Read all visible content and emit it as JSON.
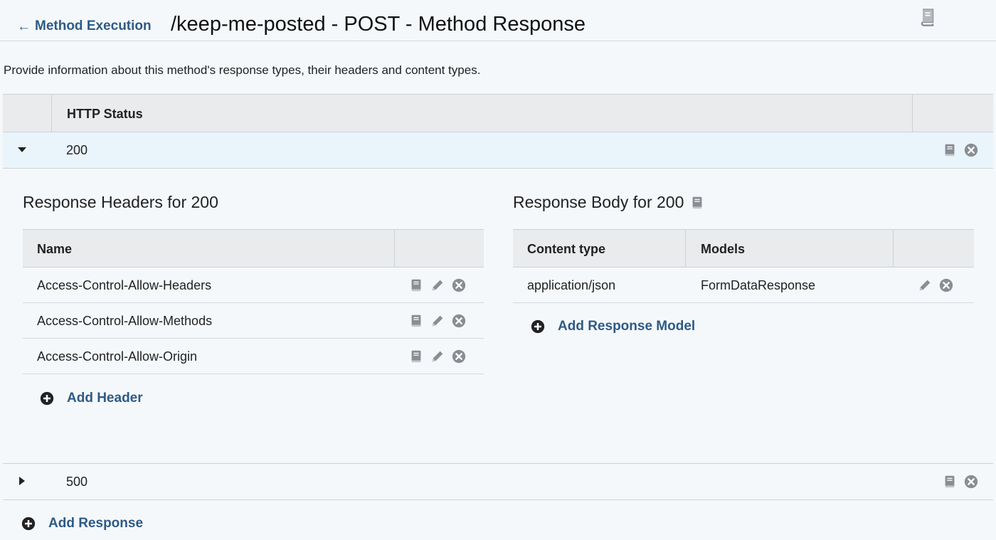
{
  "header": {
    "back_label": "Method Execution",
    "title": "/keep-me-posted - POST - Method Response"
  },
  "description": "Provide information about this method's response types, their headers and content types.",
  "status_table": {
    "column_label": "HTTP Status",
    "rows": [
      {
        "code": "200",
        "expanded": true
      },
      {
        "code": "500",
        "expanded": false
      }
    ]
  },
  "detail_200": {
    "headers_title": "Response Headers for 200",
    "headers_column": "Name",
    "headers": [
      "Access-Control-Allow-Headers",
      "Access-Control-Allow-Methods",
      "Access-Control-Allow-Origin"
    ],
    "add_header_label": "Add Header",
    "body_title": "Response Body for 200",
    "body_columns": [
      "Content type",
      "Models"
    ],
    "body_rows": [
      {
        "content_type": "application/json",
        "model": "FormDataResponse"
      }
    ],
    "add_model_label": "Add Response Model"
  },
  "add_response_label": "Add Response",
  "icons": {
    "doc": "book-icon",
    "edit": "pencil-icon",
    "remove": "close-circle-icon",
    "add": "plus-circle-icon",
    "back": "arrow-left-icon"
  },
  "colors": {
    "link": "#2e5a84",
    "icon": "#8a8e93",
    "expanded_row": "#eaf4fb"
  }
}
